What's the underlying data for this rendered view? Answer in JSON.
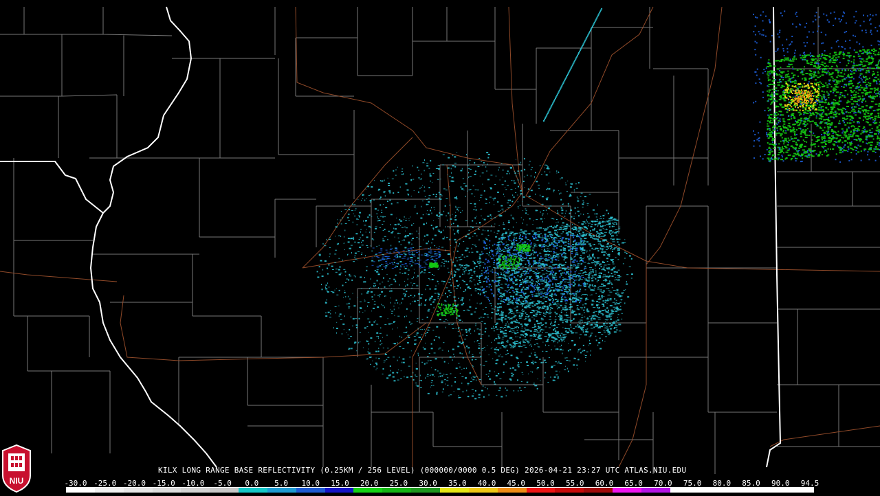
{
  "caption": "KILX LONG RANGE BASE REFLECTIVITY (0.25KM / 256 LEVEL) (000000/0000 0.5 DEG) 2026-04-21 23:27 UTC  ATLAS.NIU.EDU",
  "logo_text": "NIU",
  "scale": [
    {
      "label": "-30.0",
      "color": "#ffffff"
    },
    {
      "label": "-25.0",
      "color": "#f0f0f0"
    },
    {
      "label": "-20.0",
      "color": "#e6e6e6"
    },
    {
      "label": "-15.0",
      "color": "#dcdcdc"
    },
    {
      "label": "-10.0",
      "color": "#d2d2d2"
    },
    {
      "label": "-5.0",
      "color": "#c8c8c8"
    },
    {
      "label": "0.0",
      "color": "#14c8c8"
    },
    {
      "label": "5.0",
      "color": "#1e9bd2"
    },
    {
      "label": "10.0",
      "color": "#1e5ad2"
    },
    {
      "label": "15.0",
      "color": "#1414c8"
    },
    {
      "label": "20.0",
      "color": "#14d214"
    },
    {
      "label": "25.0",
      "color": "#14b414"
    },
    {
      "label": "30.0",
      "color": "#1e961e"
    },
    {
      "label": "35.0",
      "color": "#e6e614"
    },
    {
      "label": "40.0",
      "color": "#f0c814"
    },
    {
      "label": "45.0",
      "color": "#f08c14"
    },
    {
      "label": "50.0",
      "color": "#f01414"
    },
    {
      "label": "55.0",
      "color": "#c80a0a"
    },
    {
      "label": "60.0",
      "color": "#a00a0a"
    },
    {
      "label": "65.0",
      "color": "#f014f0"
    },
    {
      "label": "70.0",
      "color": "#b414e6"
    },
    {
      "label": "75.0",
      "color": "#ffffff"
    },
    {
      "label": "80.0",
      "color": "#ffffff"
    },
    {
      "label": "85.0",
      "color": "#ffffff"
    },
    {
      "label": "90.0",
      "color": "#ffffff"
    },
    {
      "label": "94.5",
      "color": "#ffffff"
    }
  ],
  "colors": {
    "background": "#000000",
    "county_lines": "#8c8c8c",
    "state_lines": "#ffffff",
    "highways": "#a0522d",
    "echo_low": "#2ec8d8",
    "echo_mid": "#1e64e6",
    "echo_green": "#14c814",
    "echo_yellow": "#f0dc14",
    "echo_orange": "#f08c14"
  }
}
